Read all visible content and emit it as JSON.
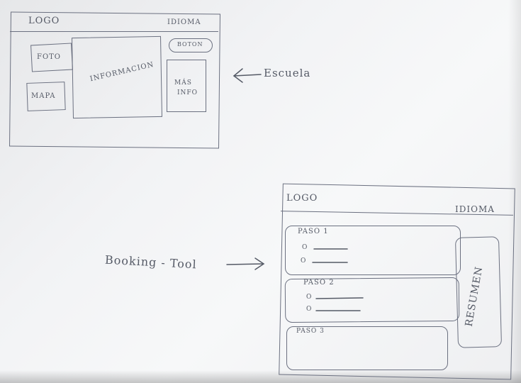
{
  "escuela": {
    "logo": "LOGO",
    "idioma": "IDIOMA",
    "button": "BOTON",
    "foto": "FOTO",
    "mapa": "MAPA",
    "informacion": "INFORMACION",
    "mas_info_line1": "MÁS",
    "mas_info_line2": "INFO",
    "label": "Escuela"
  },
  "booking": {
    "label": "Booking - Tool",
    "logo": "LOGO",
    "idioma": "IDIOMA",
    "paso1": "PASO 1",
    "paso2": "PASO 2",
    "paso3": "PASO 3",
    "bullet": "O",
    "resumen": "RESUMEN"
  }
}
